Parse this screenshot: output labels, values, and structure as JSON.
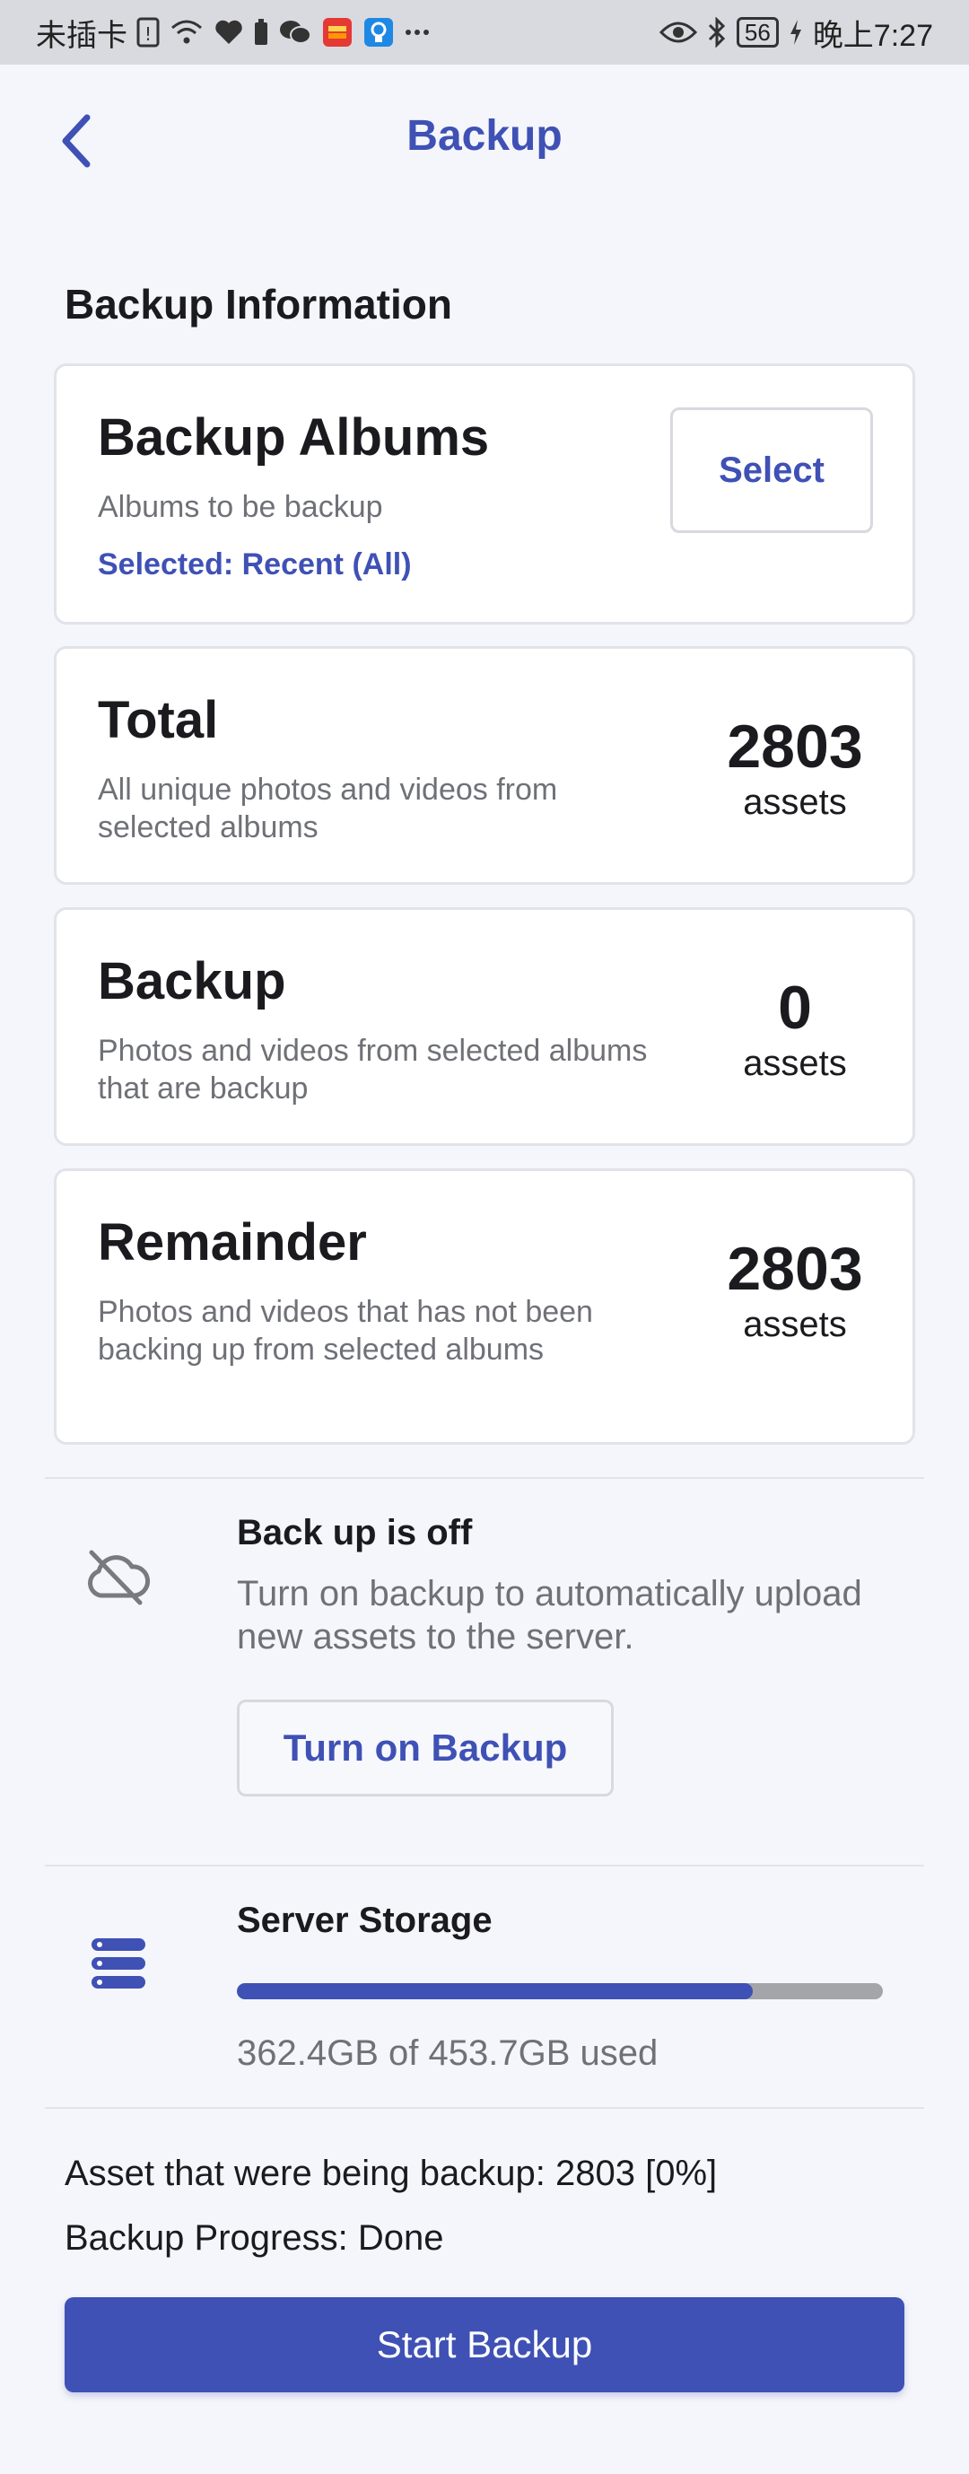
{
  "status_bar": {
    "carrier": "未插卡",
    "battery": "56",
    "time": "晚上7:27"
  },
  "app_bar": {
    "title": "Backup"
  },
  "section_title": "Backup Information",
  "albums_card": {
    "title": "Backup Albums",
    "subtitle": "Albums to be backup",
    "selected": "Selected: Recent (All)",
    "select_label": "Select"
  },
  "total_card": {
    "title": "Total",
    "subtitle": "All unique photos and videos from selected albums",
    "count": "2803",
    "unit": "assets"
  },
  "backup_card": {
    "title": "Backup",
    "subtitle": "Photos and videos from selected albums that are backup",
    "count": "0",
    "unit": "assets"
  },
  "remainder_card": {
    "title": "Remainder",
    "subtitle": "Photos and videos that has not been backing up from selected albums",
    "count": "2803",
    "unit": "assets"
  },
  "backup_status": {
    "icon": "cloud-off-icon",
    "title": "Back up is off",
    "subtitle": "Turn on backup to automatically upload new assets to the server.",
    "button_label": "Turn on Backup"
  },
  "server_storage": {
    "icon": "server-icon",
    "title": "Server Storage",
    "usage_text": "362.4GB of 453.7GB used",
    "used_fraction": 0.799
  },
  "progress": {
    "assets_line": "Asset that were being backup: 2803 [0%]",
    "status_line": "Backup Progress: Done"
  },
  "start_button_label": "Start Backup",
  "colors": {
    "accent": "#3f51b5",
    "background": "#f5f6fb",
    "muted_text": "#6f7177",
    "track": "#a4a5a9"
  }
}
